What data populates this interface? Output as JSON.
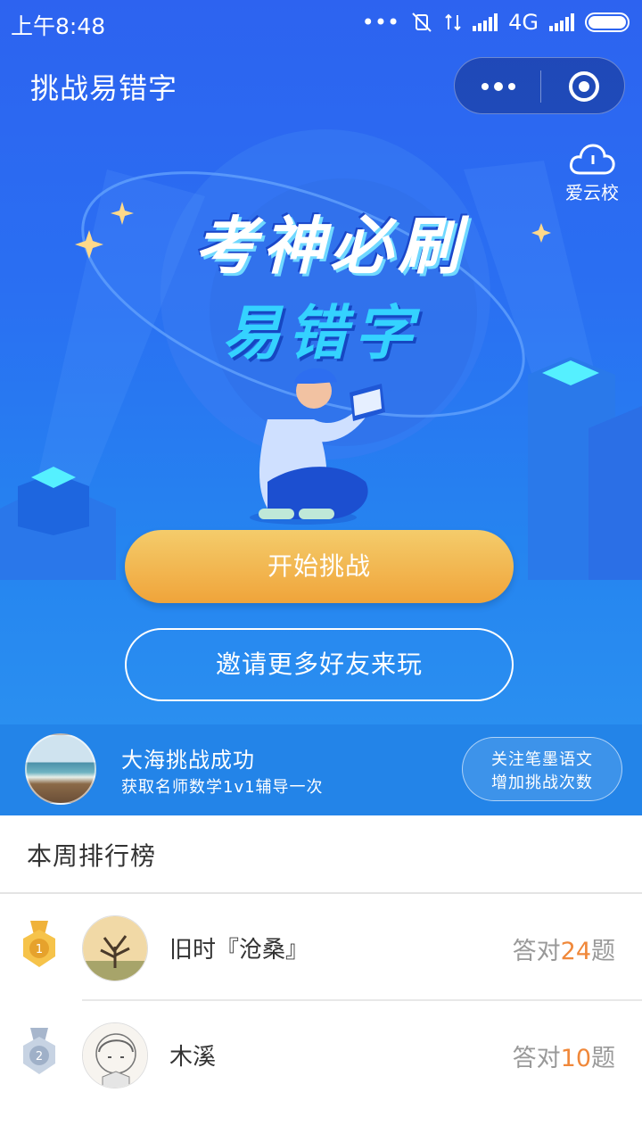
{
  "status_bar": {
    "time": "上午8:48",
    "network": "4G"
  },
  "nav": {
    "title": "挑战易错字"
  },
  "brand": {
    "name": "爱云校"
  },
  "hero": {
    "headline_line1": "考神必刷",
    "headline_line2": "易错字"
  },
  "buttons": {
    "start": "开始挑战",
    "invite": "邀请更多好友来玩"
  },
  "banner": {
    "title": "大海挑战成功",
    "subtitle": "获取名师数学1v1辅导一次",
    "follow_line1": "关注笔墨语文",
    "follow_line2": "增加挑战次数"
  },
  "ranking": {
    "header": "本周排行榜",
    "rows": [
      {
        "rank": "1",
        "name": "旧时『沧桑』",
        "score_prefix": "答对",
        "score": "24",
        "score_suffix": "题"
      },
      {
        "rank": "2",
        "name": "木溪",
        "score_prefix": "答对",
        "score": "10",
        "score_suffix": "题"
      }
    ]
  },
  "colors": {
    "hero_blue": "#2a6ff2",
    "start_button": "#f0a43a",
    "score_highlight": "#f0883a"
  }
}
